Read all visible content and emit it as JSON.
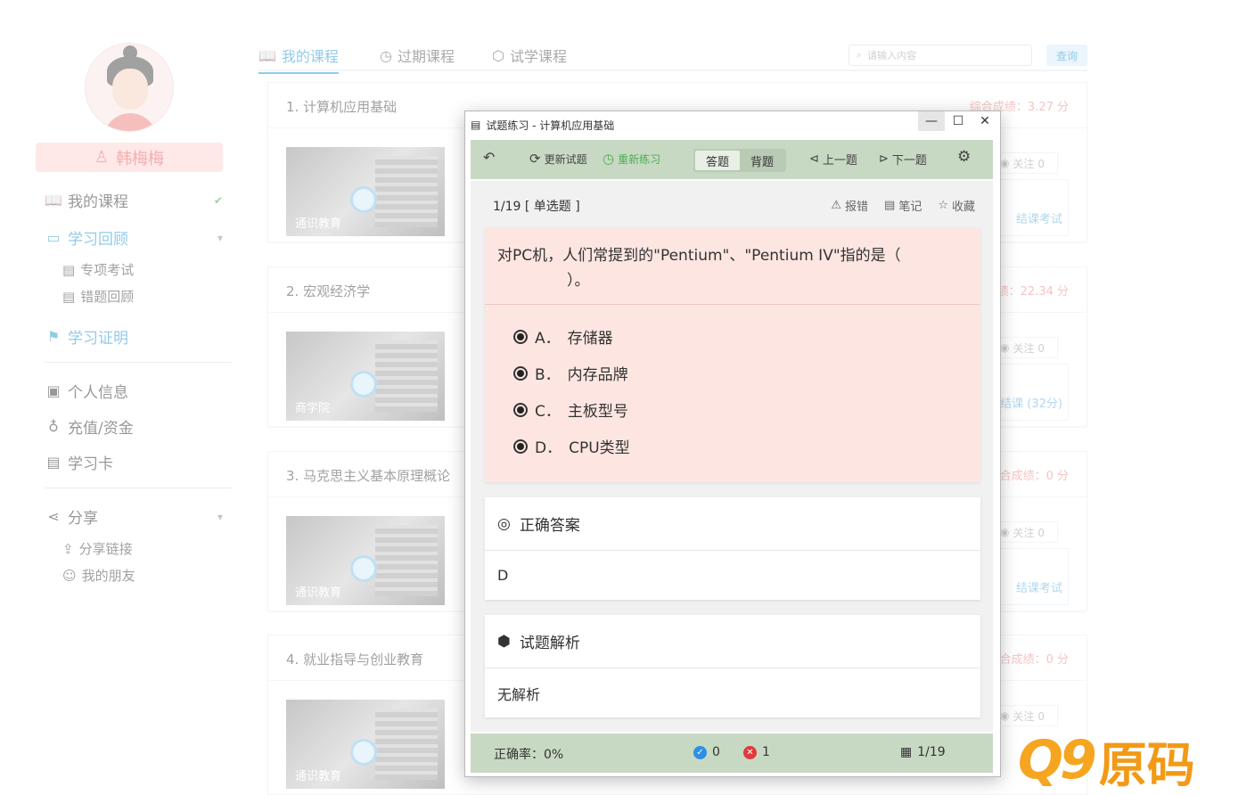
{
  "sidebar": {
    "username": "韩梅梅",
    "items": [
      {
        "label": "我的课程"
      },
      {
        "label": "学习回顾"
      },
      {
        "label": "专项考试"
      },
      {
        "label": "错题回顾"
      },
      {
        "label": "学习证明"
      },
      {
        "label": "个人信息"
      },
      {
        "label": "充值/资金"
      },
      {
        "label": "学习卡"
      },
      {
        "label": "分享"
      },
      {
        "label": "分享链接"
      },
      {
        "label": "我的朋友"
      }
    ]
  },
  "tabs": [
    {
      "label": "我的课程"
    },
    {
      "label": "过期课程"
    },
    {
      "label": "试学课程"
    }
  ],
  "search": {
    "placeholder": "请输入内容",
    "button": "查询"
  },
  "courses": [
    {
      "title": "1. 计算机应用基础",
      "category": "通识教育",
      "score": "综合成绩：3.27 分",
      "follow": "关注 0",
      "action": "结课考试"
    },
    {
      "title": "2. 宏观经济学",
      "category": "商学院",
      "score": "绩：22.34 分",
      "follow": "关注 0",
      "action": "结课 (32分)"
    },
    {
      "title": "3. 马克思主义基本原理概论",
      "category": "通识教育",
      "score": "合成绩：0 分",
      "follow": "关注 0",
      "action": "结课考试"
    },
    {
      "title": "4. 就业指导与创业教育",
      "category": "通识教育",
      "score": "合成绩：0 分",
      "follow": "关注 0",
      "action": ""
    }
  ],
  "modal": {
    "title": "试题练习 - 计算机应用基础",
    "toolbar": {
      "refresh": "更新试题",
      "restart": "重新练习",
      "mode_answer": "答题",
      "mode_memorize": "背题",
      "prev": "上一题",
      "next": "下一题"
    },
    "question": {
      "index": "1/19 [ 单选题 ]",
      "report": "报错",
      "note": "笔记",
      "favorite": "收藏",
      "text_line1": "对PC机，人们常提到的\"Pentium\"、\"Pentium IV\"指的是（",
      "text_line2": "）。",
      "options": [
        {
          "letter": "A．",
          "text": "存储器"
        },
        {
          "letter": "B．",
          "text": "内存品牌"
        },
        {
          "letter": "C．",
          "text": "主板型号"
        },
        {
          "letter": "D．",
          "text": "CPU类型"
        }
      ]
    },
    "answer": {
      "heading": "正确答案",
      "value": "D"
    },
    "analysis": {
      "heading": "试题解析",
      "value": "无解析"
    },
    "status": {
      "accuracy": "正确率：0%",
      "correct": "0",
      "wrong": "1",
      "progress": "1/19"
    }
  },
  "watermark": {
    "text": "Q9原码"
  }
}
